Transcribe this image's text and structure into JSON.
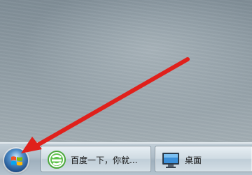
{
  "taskbar": {
    "start_button": {
      "icon": "windows-orb-icon"
    },
    "items": [
      {
        "label": "百度一下，你就...",
        "icon": "ie-browser-icon"
      },
      {
        "label": "桌面",
        "icon": "desktop-monitor-icon"
      }
    ]
  },
  "annotation": {
    "arrow_color": "#e0201b"
  }
}
